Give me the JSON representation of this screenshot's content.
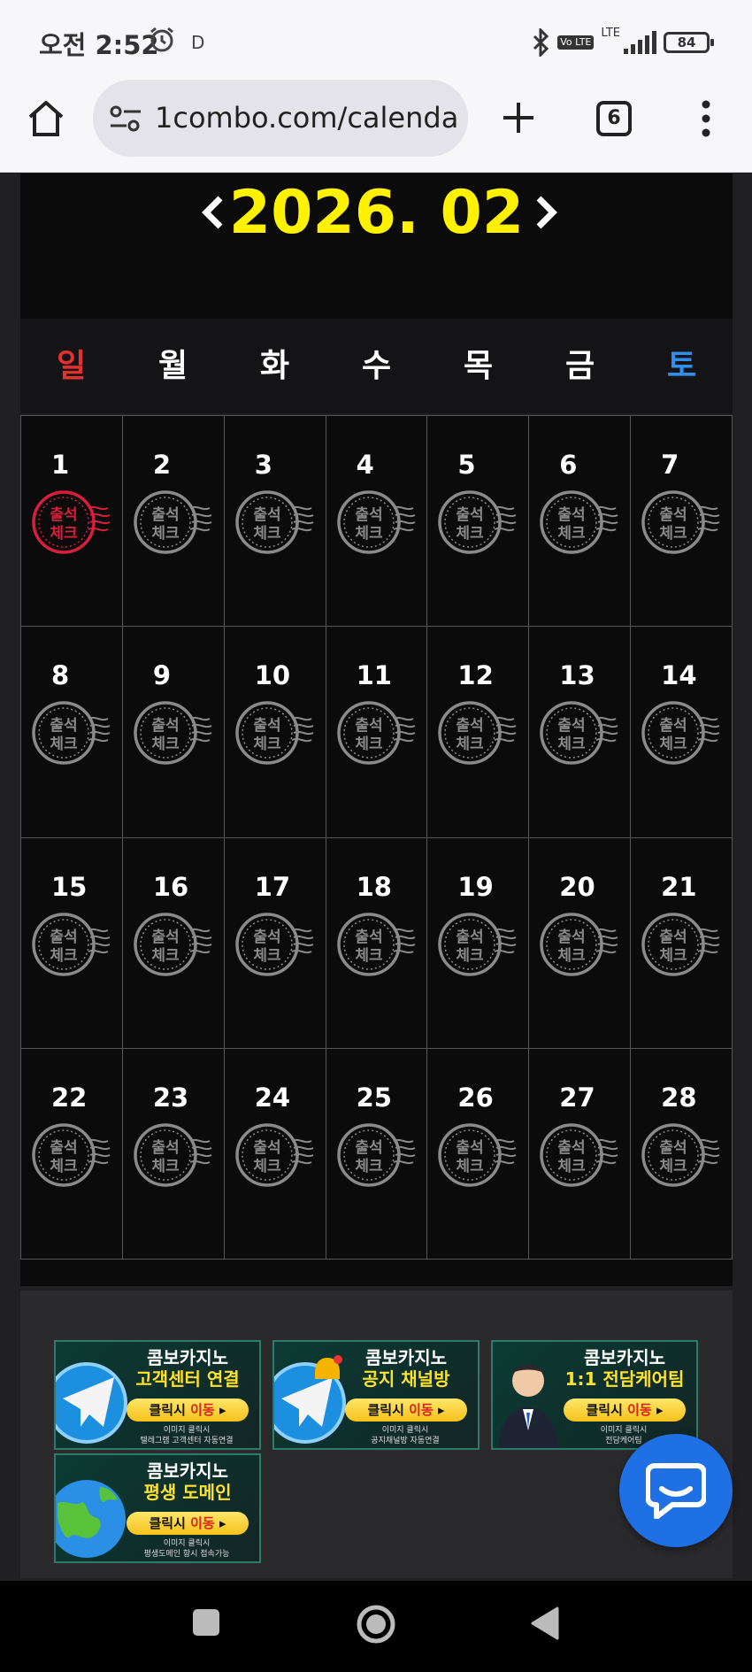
{
  "status_bar": {
    "time": "오전 2:52",
    "indicator": "D",
    "volte": "Vo LTE",
    "network": "LTE",
    "battery": "84"
  },
  "browser": {
    "url": "1combo.com/calenda",
    "tab_count": "6"
  },
  "calendar": {
    "month_title": "2026. 02",
    "weekdays": [
      "일",
      "월",
      "화",
      "수",
      "목",
      "금",
      "토"
    ],
    "days": [
      "1",
      "2",
      "3",
      "4",
      "5",
      "6",
      "7",
      "8",
      "9",
      "10",
      "11",
      "12",
      "13",
      "14",
      "15",
      "16",
      "17",
      "18",
      "19",
      "20",
      "21",
      "22",
      "23",
      "24",
      "25",
      "26",
      "27",
      "28"
    ],
    "stamp_text_line1": "출석",
    "stamp_text_line2": "체크",
    "checked_days": [
      "1"
    ],
    "colors": {
      "title": "#fff200",
      "sunday": "#e53030",
      "saturday": "#2e8ff0",
      "stamp_checked": "#d81e3a",
      "stamp_unchecked": "#8a8a8a"
    }
  },
  "banners": [
    {
      "title_white": "콤보카지노",
      "title_yellow": "고객센터 연결",
      "button_a": "클릭시 ",
      "button_b": "이동",
      "sub1": "이미지 클릭시",
      "sub2": "텔레그램 고객센터 자동연결"
    },
    {
      "title_white": "콤보카지노",
      "title_yellow": "공지 채널방",
      "button_a": "클릭시 ",
      "button_b": "이동",
      "sub1": "이미지 클릭시",
      "sub2": "공지채널방 자동연결"
    },
    {
      "title_white": "콤보카지노",
      "title_yellow": "1:1 전담케어팀",
      "button_a": "클릭시 ",
      "button_b": "이동",
      "sub1": "이미지 클릭시",
      "sub2": "전담케어팀"
    },
    {
      "title_white": "콤보카지노",
      "title_yellow": "평생 도메인",
      "button_a": "클릭시 ",
      "button_b": "이동",
      "sub1": "이미지 클릭시",
      "sub2": "평생도메인 항시 접속가능"
    }
  ]
}
